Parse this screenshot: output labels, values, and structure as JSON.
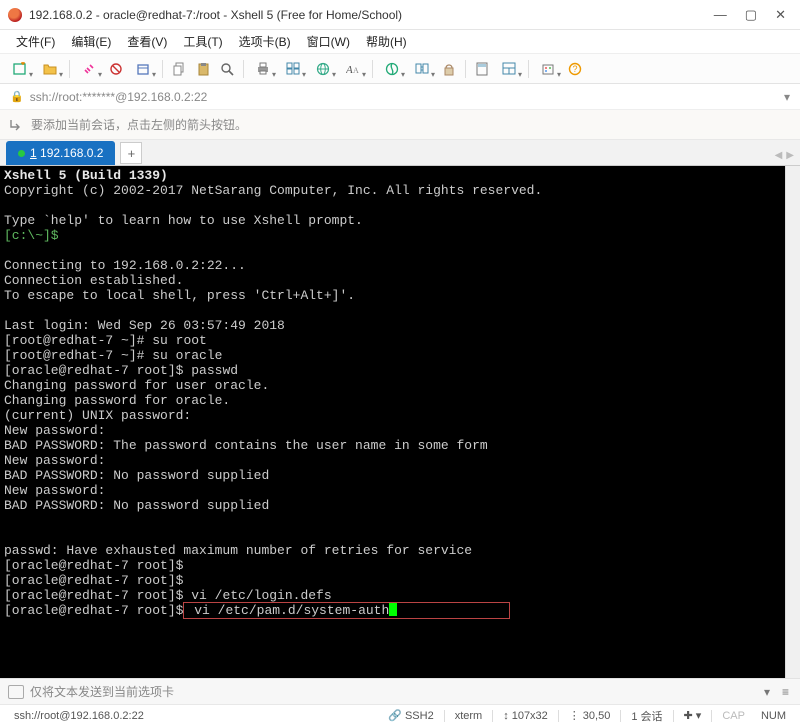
{
  "titlebar": {
    "title": "192.168.0.2 - oracle@redhat-7:/root - Xshell 5 (Free for Home/School)"
  },
  "menu": {
    "file": "文件(F)",
    "edit": "编辑(E)",
    "view": "查看(V)",
    "tools": "工具(T)",
    "tabs": "选项卡(B)",
    "window": "窗口(W)",
    "help": "帮助(H)"
  },
  "addressbar": {
    "text": "ssh://root:*******@192.168.0.2:22"
  },
  "infobar": {
    "text": "要添加当前会话，点击左侧的箭头按钮。"
  },
  "tab": {
    "index": "1",
    "label": "192.168.0.2"
  },
  "terminal": {
    "l01": "Xshell 5 (Build 1339)",
    "l02": "Copyright (c) 2002-2017 NetSarang Computer, Inc. All rights reserved.",
    "l03": "Type `help' to learn how to use Xshell prompt.",
    "l04a": "[c:\\~]$",
    "l05": "Connecting to 192.168.0.2:22...",
    "l06": "Connection established.",
    "l07": "To escape to local shell, press 'Ctrl+Alt+]'.",
    "l08": "Last login: Wed Sep 26 03:57:49 2018",
    "l09p": "[root@redhat-7 ~]#",
    "l09c": " su root",
    "l10p": "[root@redhat-7 ~]#",
    "l10c": " su oracle",
    "l11p": "[oracle@redhat-7 root]$",
    "l11c": " passwd",
    "l12": "Changing password for user oracle.",
    "l13": "Changing password for oracle.",
    "l14": "(current) UNIX password:",
    "l15": "New password:",
    "l16": "BAD PASSWORD: The password contains the user name in some form",
    "l17": "New password:",
    "l18": "BAD PASSWORD: No password supplied",
    "l19": "New password:",
    "l20": "BAD PASSWORD: No password supplied",
    "l21": "passwd: Have exhausted maximum number of retries for service",
    "l22p": "[oracle@redhat-7 root]$",
    "l23p": "[oracle@redhat-7 root]$",
    "l24p": "[oracle@redhat-7 root]$",
    "l24c": " vi /etc/login.defs",
    "l25p": "[oracle@redhat-7 root]$",
    "l25c": " vi /etc/pam.d/system-auth"
  },
  "bottombar": {
    "text": "仅将文本发送到当前选项卡"
  },
  "statusbar": {
    "conn": "ssh://root@192.168.0.2:22",
    "proto": "SSH2",
    "term": "xterm",
    "size": "107x32",
    "cursor": "30,50",
    "sessions": "1 会话",
    "cap": "CAP",
    "num": "NUM"
  }
}
